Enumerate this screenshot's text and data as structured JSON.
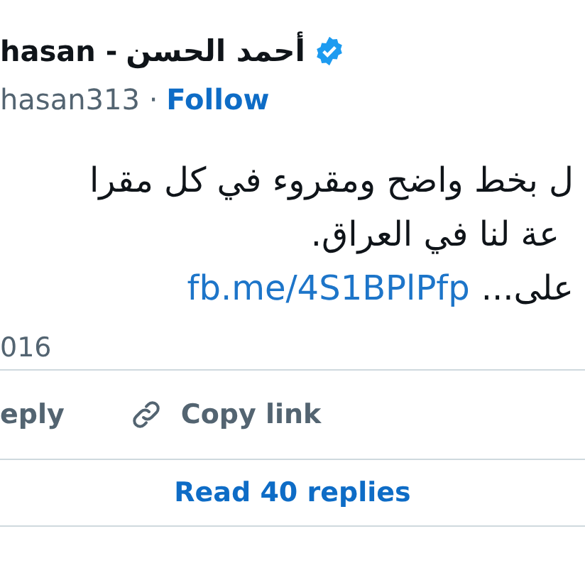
{
  "author": {
    "name_latin": "hasan -",
    "name_arabic": "أحمد الحسن",
    "verified": true,
    "handle": "hasan313 ·",
    "follow": "Follow"
  },
  "body": {
    "lines": [
      "ل بخط واضح ومقروء في كل مقرا",
      "عة لنا في العراق."
    ],
    "last_line": "على...",
    "link": "fb.me/4S1BPlPfp"
  },
  "date": "016",
  "reply_action": {
    "label": "eply"
  },
  "copy_link_action": {
    "label": "Copy link"
  },
  "read_replies": "Read 40 replies"
}
